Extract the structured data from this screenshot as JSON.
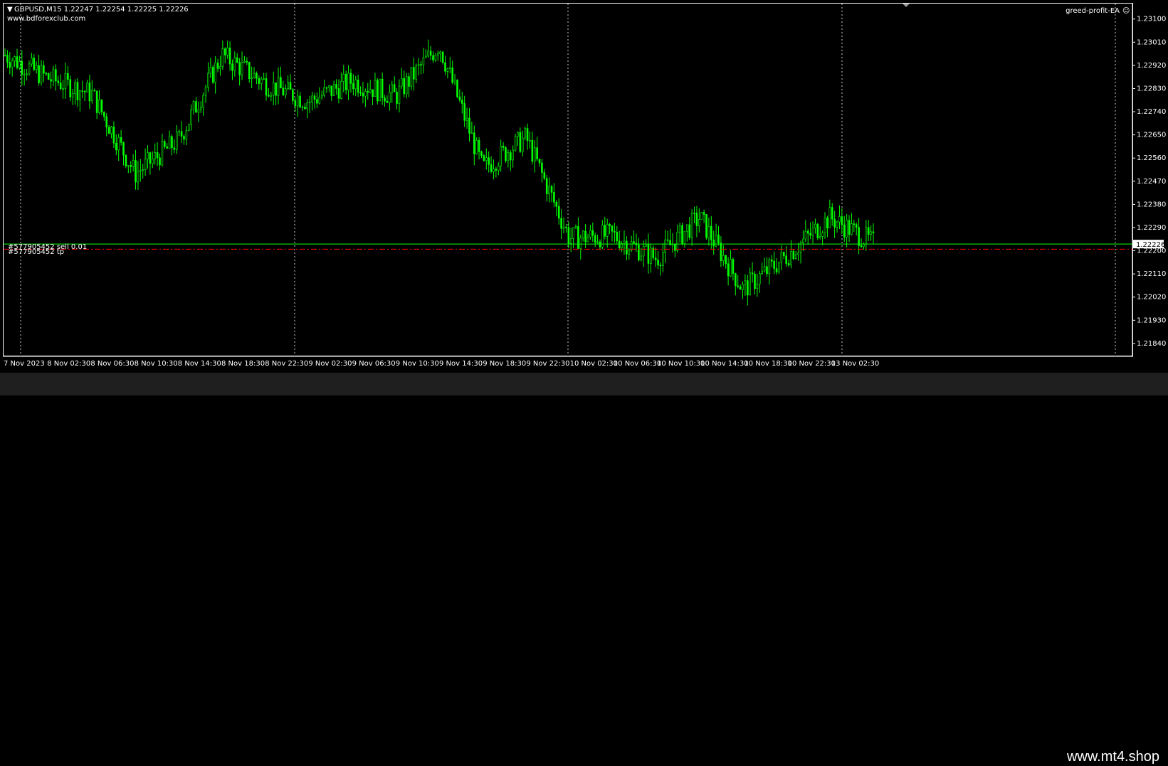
{
  "header": {
    "symbol_line": "GBPUSD,M15  1.22247 1.22254 1.22225 1.22226",
    "website": "www.bdforexclub.com",
    "ea_label": "greed-profit-EA"
  },
  "orders": {
    "sell_label": "#577905452 sell 0.01",
    "tp_label": "#577905452 tp",
    "current_price": "1.22226"
  },
  "y_axis": {
    "labels": [
      "1.23100",
      "1.23010",
      "1.22920",
      "1.22830",
      "1.22740",
      "1.22650",
      "1.22560",
      "1.22470",
      "1.22380",
      "1.22290",
      "1.22200",
      "1.22110",
      "1.22020",
      "1.21930",
      "1.21840"
    ]
  },
  "x_axis": {
    "labels": [
      "7 Nov 2023",
      "8 Nov 02:30",
      "8 Nov 06:30",
      "8 Nov 10:30",
      "8 Nov 14:30",
      "8 Nov 18:30",
      "8 Nov 22:30",
      "9 Nov 02:30",
      "9 Nov 06:30",
      "9 Nov 10:30",
      "9 Nov 14:30",
      "9 Nov 18:30",
      "9 Nov 22:30",
      "10 Nov 02:30",
      "10 Nov 06:30",
      "10 Nov 10:30",
      "10 Nov 14:30",
      "10 Nov 18:30",
      "10 Nov 22:30",
      "13 Nov 02:30"
    ]
  },
  "colors": {
    "background": "#000000",
    "candles": "#00ff00",
    "order_line": "#00ff00",
    "tp_line": "#ff0000",
    "grid": "#c8c8c8",
    "footer": "#1f1f1f"
  },
  "chart_data": {
    "type": "line",
    "symbol": "GBPUSD",
    "timeframe": "M15",
    "ylim": [
      1.2179,
      1.2316
    ],
    "grid": "vertical dotted",
    "x": [
      "7 Nov 2023",
      "8 Nov 02:30",
      "8 Nov 06:30",
      "8 Nov 10:30",
      "8 Nov 14:30",
      "8 Nov 18:30",
      "8 Nov 22:30",
      "9 Nov 02:30",
      "9 Nov 06:30",
      "9 Nov 10:30",
      "9 Nov 14:30",
      "9 Nov 18:30",
      "9 Nov 22:30",
      "10 Nov 02:30",
      "10 Nov 06:30",
      "10 Nov 10:30",
      "10 Nov 14:30",
      "10 Nov 18:30",
      "10 Nov 22:30",
      "13 Nov 02:30",
      "13 Nov 04:00"
    ],
    "series": [
      {
        "values": [
          1.2296,
          1.2287,
          1.2281,
          1.225,
          1.2263,
          1.2296,
          1.2285,
          1.2278,
          1.2286,
          1.228,
          1.23,
          1.2252,
          1.2264,
          1.2225,
          1.2226,
          1.2217,
          1.2233,
          1.2205,
          1.2218,
          1.2233,
          1.2223
        ]
      }
    ],
    "lines": [
      {
        "label": "#577905452 sell 0.01",
        "value": 1.22226
      },
      {
        "label": "#577905452 tp",
        "value": 1.22206
      }
    ],
    "current_price": 1.22226
  },
  "footer": {
    "watermark": "www.mt4.shop"
  }
}
